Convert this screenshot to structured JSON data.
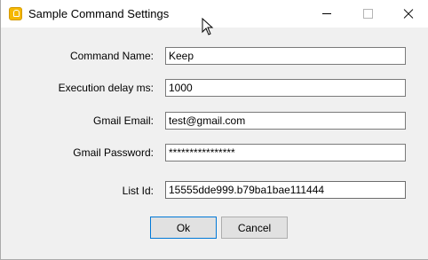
{
  "window": {
    "title": "Sample Command Settings"
  },
  "form": {
    "command_name": {
      "label": "Command Name:",
      "value": "Keep"
    },
    "execution_delay": {
      "label": "Execution delay ms:",
      "value": "1000"
    },
    "gmail_email": {
      "label": "Gmail Email:",
      "value": "test@gmail.com"
    },
    "gmail_password": {
      "label": "Gmail Password:",
      "value": "****************"
    },
    "list_id": {
      "label": "List Id:",
      "value": "15555dde999.b79ba1bae111444"
    }
  },
  "buttons": {
    "ok_label": "Ok",
    "cancel_label": "Cancel"
  },
  "icons": {
    "app": "lightbulb-icon",
    "minimize": "minimize-icon",
    "maximize": "maximize-icon",
    "close": "close-icon",
    "cursor": "mouse-cursor-icon"
  },
  "colors": {
    "app_icon": "#f5b800",
    "default_button_border": "#0078d7"
  }
}
